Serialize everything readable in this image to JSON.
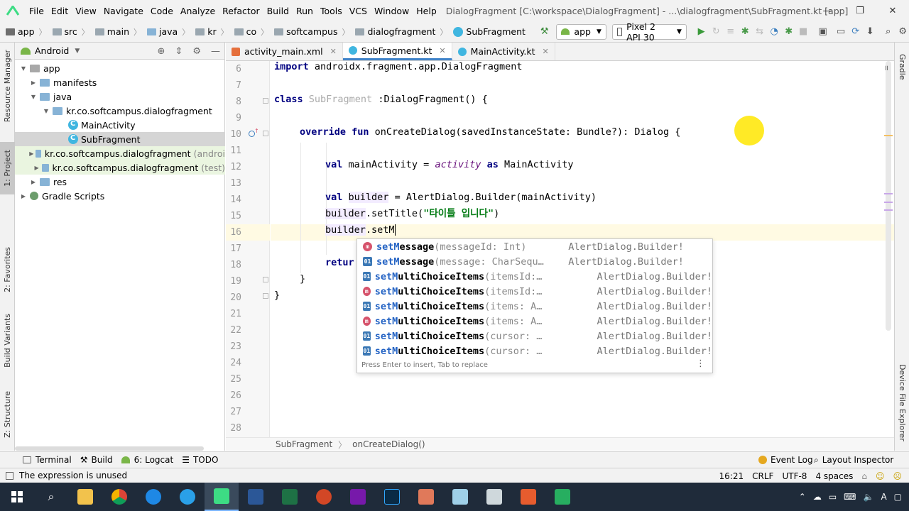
{
  "menubar": {
    "items": [
      "File",
      "Edit",
      "View",
      "Navigate",
      "Code",
      "Analyze",
      "Refactor",
      "Build",
      "Run",
      "Tools",
      "VCS",
      "Window",
      "Help"
    ],
    "window_title": "DialogFragment [C:\\workspace\\DialogFragment] - ...\\dialogfragment\\SubFragment.kt [app]",
    "minimize": "—",
    "maximize": "❐",
    "close": "✕"
  },
  "navbar": {
    "crumbs": [
      "app",
      "src",
      "main",
      "java",
      "kr",
      "co",
      "softcampus",
      "dialogfragment",
      "SubFragment"
    ],
    "run_config": "app",
    "device": "Pixel 2 API 30"
  },
  "left_strip": {
    "tabs": [
      "Resource Manager",
      "1: Project",
      "2: Favorites",
      "Build Variants",
      "Z: Structure"
    ]
  },
  "right_strip": {
    "tabs": [
      "Gradle",
      "Device File Explorer"
    ]
  },
  "project": {
    "view": "Android",
    "tree": [
      {
        "label": "app",
        "extra": ""
      },
      {
        "label": "manifests",
        "extra": ""
      },
      {
        "label": "java",
        "extra": ""
      },
      {
        "label": "kr.co.softcampus.dialogfragment",
        "extra": ""
      },
      {
        "label": "MainActivity",
        "extra": ""
      },
      {
        "label": "SubFragment",
        "extra": ""
      },
      {
        "label": "kr.co.softcampus.dialogfragment",
        "extra": "(androi"
      },
      {
        "label": "kr.co.softcampus.dialogfragment",
        "extra": "(test)"
      },
      {
        "label": "res",
        "extra": ""
      },
      {
        "label": "Gradle Scripts",
        "extra": ""
      }
    ]
  },
  "tabs": [
    {
      "label": "activity_main.xml"
    },
    {
      "label": "SubFragment.kt"
    },
    {
      "label": "MainActivity.kt"
    }
  ],
  "editor": {
    "line_numbers": [
      "6",
      "7",
      "8",
      "9",
      "10",
      "11",
      "12",
      "13",
      "14",
      "15",
      "16",
      "17",
      "18",
      "19",
      "20",
      "21",
      "22",
      "23",
      "24",
      "25",
      "26",
      "27",
      "28"
    ],
    "l6_kw": "import",
    "l6_rest": " androidx.fragment.app.DialogFragment",
    "l8_kw": "class",
    "l8_cls": "SubFragment",
    "l8_rest": " :DialogFragment() {",
    "l10_kw": "override fun",
    "l10_rest": " onCreateDialog(savedInstanceState: Bundle?): Dialog {",
    "l12_kw": "val",
    "l12_a": " mainActivity = ",
    "l12_it": "activity",
    "l12_kw2": " as",
    "l12_b": " MainActivity",
    "l14_kw": "val",
    "l14_var": "builder",
    "l14_rest": " = AlertDialog.Builder(mainActivity)",
    "l15_a": "builder",
    "l15_b": ".setTitle(",
    "l15_str": "\"타이틀 입니다\"",
    "l15_c": ")",
    "l16_a": "builder",
    "l16_b": ".setM",
    "l18_kw": "retur",
    "l19": "}",
    "l20": "}"
  },
  "autocomplete": {
    "items": [
      {
        "icon": "m",
        "prefix": "setM",
        "name_rest": "essage",
        "args": "(messageId: Int)",
        "type": "AlertDialog.Builder!"
      },
      {
        "icon": "p",
        "prefix": "setM",
        "name_rest": "essage",
        "args": "(message: CharSequ…",
        "type": "AlertDialog.Builder!"
      },
      {
        "icon": "p",
        "prefix": "setM",
        "name_rest": "ultiChoiceItems",
        "args": "(itemsId:…",
        "type": "AlertDialog.Builder!"
      },
      {
        "icon": "m",
        "prefix": "setM",
        "name_rest": "ultiChoiceItems",
        "args": "(itemsId:…",
        "type": "AlertDialog.Builder!"
      },
      {
        "icon": "p",
        "prefix": "setM",
        "name_rest": "ultiChoiceItems",
        "args": "(items: A…",
        "type": "AlertDialog.Builder!"
      },
      {
        "icon": "m",
        "prefix": "setM",
        "name_rest": "ultiChoiceItems",
        "args": "(items: A…",
        "type": "AlertDialog.Builder!"
      },
      {
        "icon": "p",
        "prefix": "setM",
        "name_rest": "ultiChoiceItems",
        "args": "(cursor: …",
        "type": "AlertDialog.Builder!"
      },
      {
        "icon": "p",
        "prefix": "setM",
        "name_rest": "ultiChoiceItems",
        "args": "(cursor: …",
        "type": "AlertDialog.Builder!"
      }
    ],
    "footer": "Press Enter to insert, Tab to replace",
    "more": "⋮"
  },
  "edcrumb": {
    "a": "SubFragment",
    "b": "onCreateDialog()"
  },
  "bottombar": {
    "terminal": "Terminal",
    "build": "Build",
    "logcat": "6: Logcat",
    "todo": "TODO",
    "event_log": "Event Log",
    "layout_inspector": "Layout Inspector"
  },
  "status": {
    "message": "The expression is unused",
    "position": "16:21",
    "line_sep": "CRLF",
    "encoding": "UTF-8",
    "indent": "4 spaces"
  },
  "colors": {
    "accent": "#4083c9",
    "keyword": "#000080",
    "string": "#067d17",
    "completion": "#2463c4"
  }
}
